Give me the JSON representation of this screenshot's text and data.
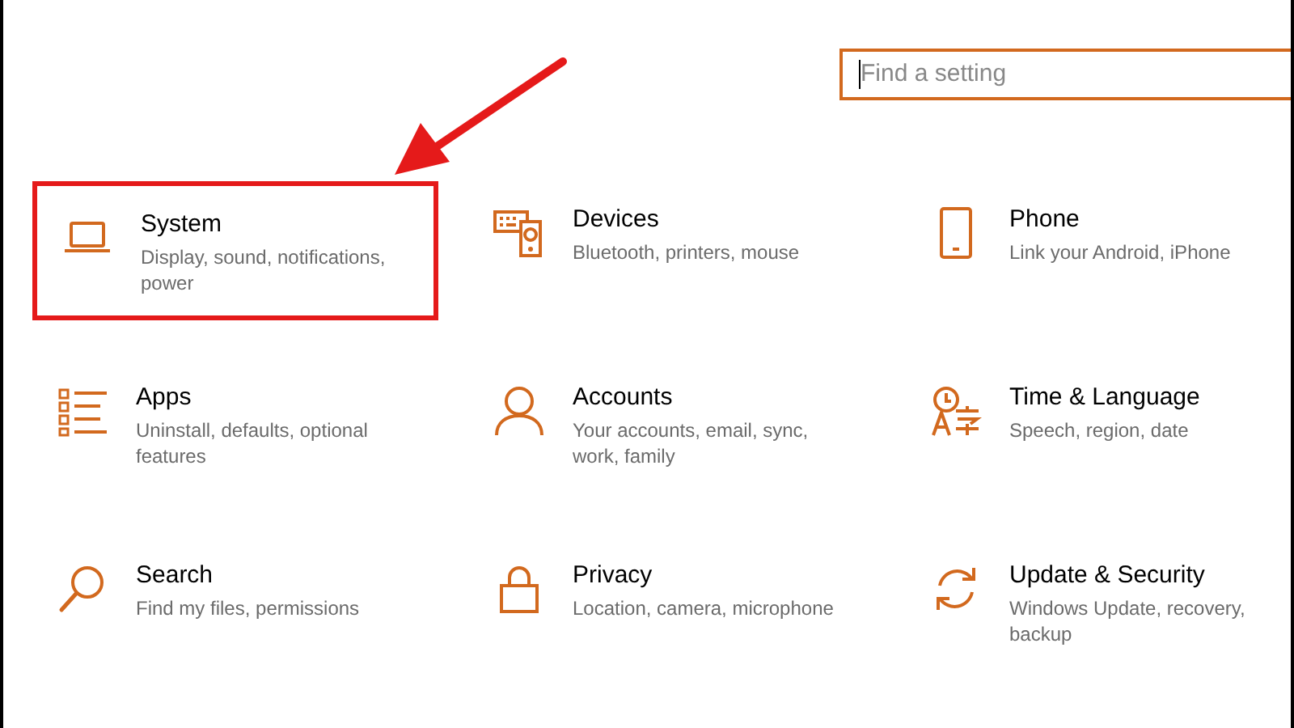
{
  "search": {
    "placeholder": "Find a setting",
    "focused": true
  },
  "items": [
    {
      "kind": "laptop",
      "title": "System",
      "description": "Display, sound, notifications, power",
      "highlighted": true
    },
    {
      "kind": "devices",
      "title": "Devices",
      "description": "Bluetooth, printers, mouse",
      "highlighted": false
    },
    {
      "kind": "phone",
      "title": "Phone",
      "description": "Link your Android, iPhone",
      "highlighted": false
    },
    {
      "kind": "apps",
      "title": "Apps",
      "description": "Uninstall, defaults, optional features",
      "highlighted": false
    },
    {
      "kind": "person",
      "title": "Accounts",
      "description": "Your accounts, email, sync, work, family",
      "highlighted": false
    },
    {
      "kind": "time",
      "title": "Time & Language",
      "description": "Speech, region, date",
      "highlighted": false
    },
    {
      "kind": "search",
      "title": "Search",
      "description": "Find my files, permissions",
      "highlighted": false
    },
    {
      "kind": "lock",
      "title": "Privacy",
      "description": "Location, camera, microphone",
      "highlighted": false
    },
    {
      "kind": "sync",
      "title": "Update & Security",
      "description": "Windows Update, recovery, backup",
      "highlighted": false
    }
  ]
}
